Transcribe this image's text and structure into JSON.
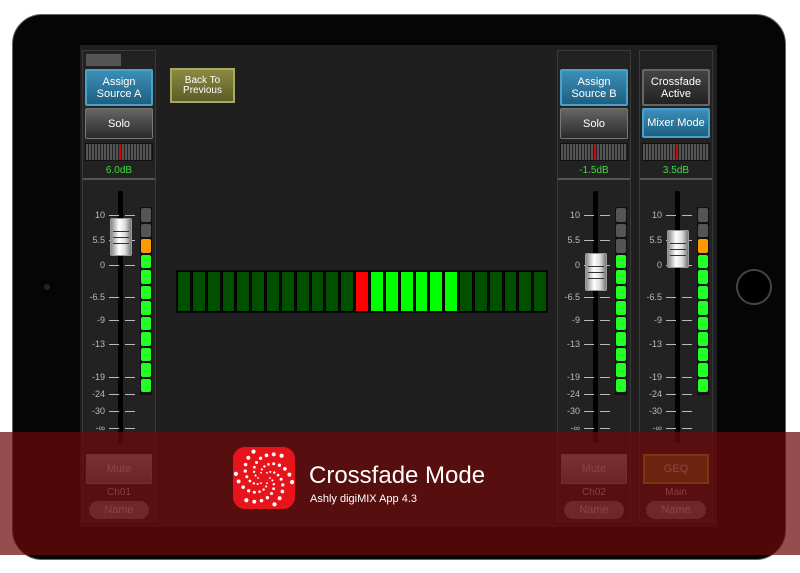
{
  "scale_labels": [
    "10",
    "5.5",
    "0",
    "-6.5",
    "-9",
    "-13",
    "-19",
    "-24",
    "-30",
    "-∞"
  ],
  "channels": [
    {
      "id": "ch01",
      "assign": "Assign Source A",
      "second": "Solo",
      "level": "6.0dB",
      "fader_db": 6.0,
      "leds": [
        "off",
        "off",
        "orange",
        "green",
        "green",
        "green",
        "green",
        "green",
        "green",
        "green",
        "green",
        "green"
      ],
      "bottom": "Mute",
      "label": "Ch01",
      "name": "Name"
    },
    {
      "id": "ch02",
      "assign": "Assign Source B",
      "second": "Solo",
      "level": "-1.5dB",
      "fader_db": -1.5,
      "leds": [
        "off",
        "off",
        "off",
        "green",
        "green",
        "green",
        "green",
        "green",
        "green",
        "green",
        "green",
        "green"
      ],
      "bottom": "Mute",
      "label": "Ch02",
      "name": "Name"
    },
    {
      "id": "main",
      "assign": "Crossfade Active",
      "second": "Mixer Mode",
      "level": "3.5dB",
      "fader_db": 3.5,
      "leds": [
        "off",
        "off",
        "orange",
        "green",
        "green",
        "green",
        "green",
        "green",
        "green",
        "green",
        "green",
        "green"
      ],
      "bottom": "GEQ",
      "label": "Main",
      "name": "Name"
    }
  ],
  "back_button": "Back To Previous",
  "crossfade_meter": {
    "segments": 25,
    "red_index": 12,
    "lit": [
      13,
      14,
      15,
      16,
      17,
      18
    ]
  },
  "banner": {
    "title": "Crossfade Mode",
    "subtitle": "Ashly digiMIX App 4.3"
  },
  "colors": {
    "led_green": "#22ff22",
    "led_orange": "#ff9900",
    "led_off": "#555555",
    "meter_dark": "#005000",
    "meter_lit": "#00ff00",
    "meter_red": "#ff0000",
    "accent_blue": "#2a7aa5",
    "banner": "#6e0808"
  }
}
